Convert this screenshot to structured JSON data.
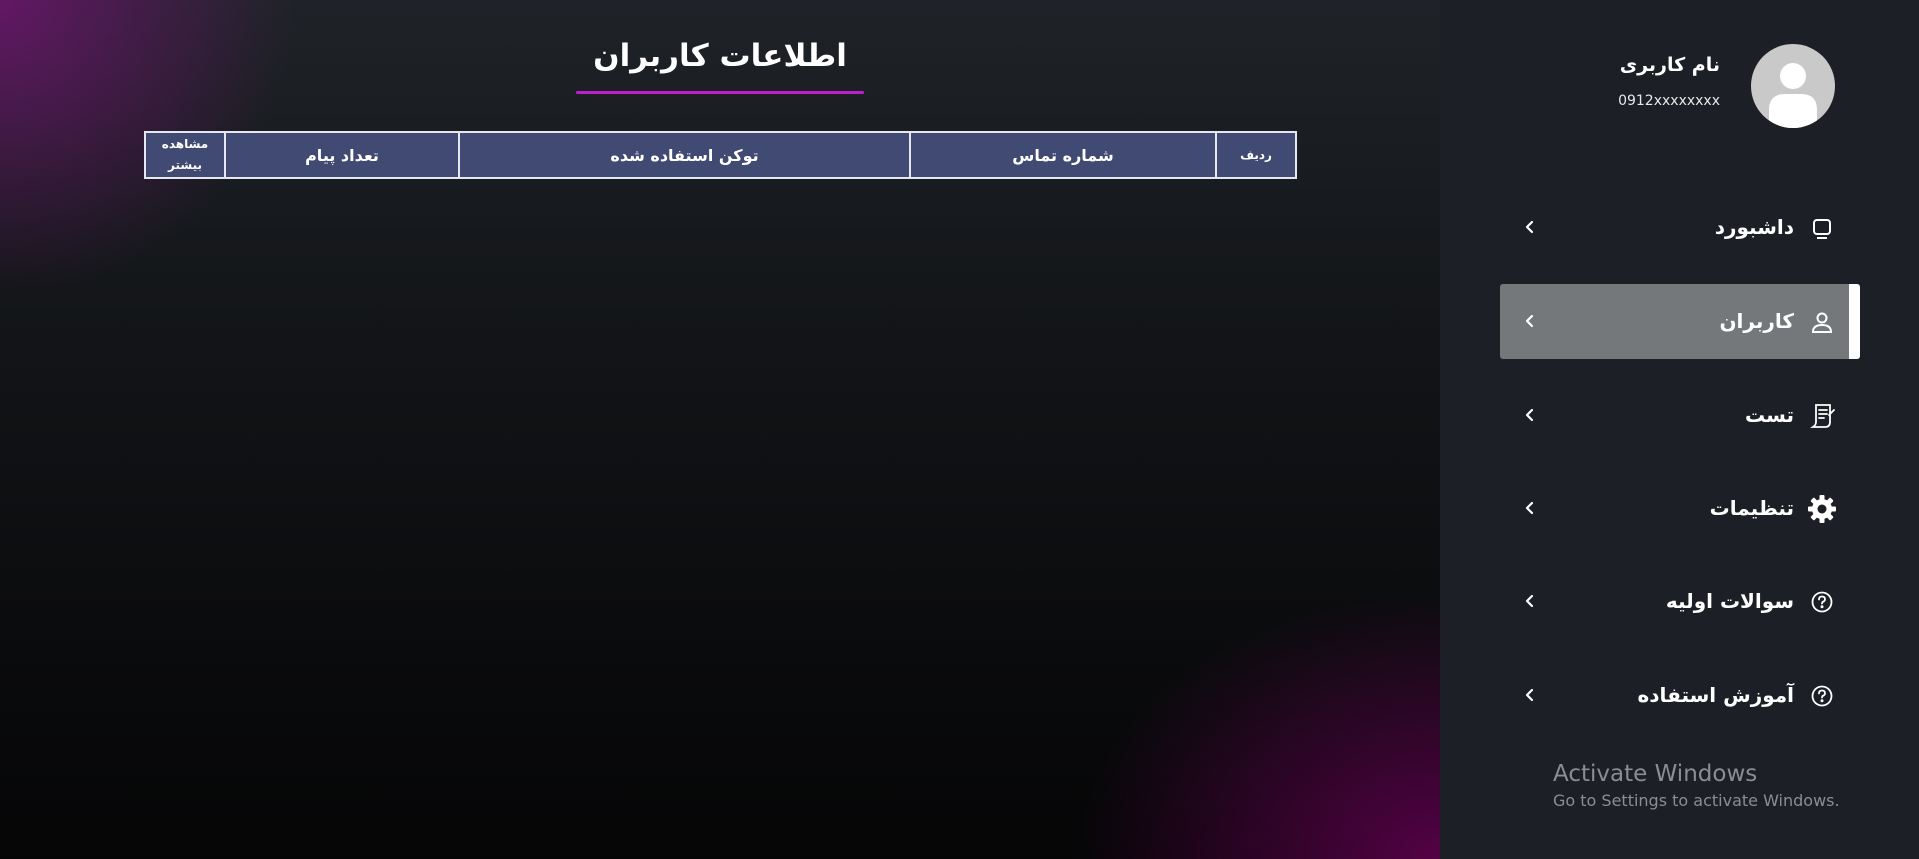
{
  "main": {
    "title": "اطلاعات کاربران",
    "accent_color": "#c01ec8",
    "table": {
      "columns": [
        "ردیف",
        "شماره تماس",
        "توکن استفاده شده",
        "تعداد پیام",
        "مشاهده بیشتر"
      ],
      "rows": []
    }
  },
  "sidebar": {
    "user": {
      "name": "نام کاربری",
      "phone": "0912xxxxxxxx",
      "avatar_icon": "avatar-icon"
    },
    "items": [
      {
        "label": "داشبورد",
        "icon": "dashboard-icon",
        "active": false
      },
      {
        "label": "کاربران",
        "icon": "user-icon",
        "active": true
      },
      {
        "label": "تست",
        "icon": "test-document-icon",
        "active": false
      },
      {
        "label": "تنظیمات",
        "icon": "gear-icon",
        "active": false
      },
      {
        "label": "سوالات اولیه",
        "icon": "question-circle-icon",
        "active": false
      },
      {
        "label": "آموزش استفاده",
        "icon": "question-circle-icon",
        "active": false
      }
    ]
  },
  "watermark": {
    "title": "Activate Windows",
    "subtitle": "Go to Settings to activate Windows."
  }
}
